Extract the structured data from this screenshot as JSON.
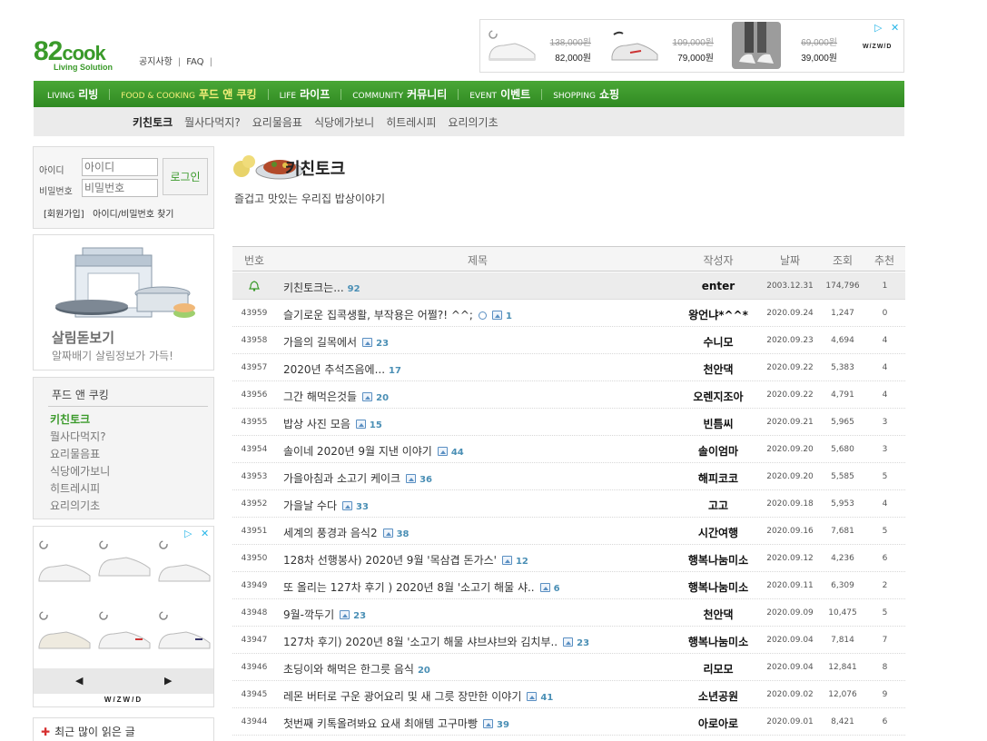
{
  "header": {
    "logo_text": "82cook",
    "logo_sub": "Living Solution",
    "links": [
      "공지사항",
      "FAQ"
    ]
  },
  "top_ad": {
    "items": [
      {
        "old_price": "138,000원",
        "new_price": "82,000원"
      },
      {
        "old_price": "109,000원",
        "new_price": "79,000원"
      },
      {
        "old_price": "69,000원",
        "new_price": "39,000원"
      }
    ],
    "brand": "W/ZW/D",
    "adchoice": "▷",
    "close": "✕"
  },
  "nav": [
    {
      "en": "LIVING",
      "ko": "리빙",
      "active": false
    },
    {
      "en": "FOOD & COOKING",
      "ko": "푸드 앤 쿠킹",
      "active": true
    },
    {
      "en": "LIFE",
      "ko": "라이프",
      "active": false
    },
    {
      "en": "COMMUNITY",
      "ko": "커뮤니티",
      "active": false
    },
    {
      "en": "EVENT",
      "ko": "이벤트",
      "active": false
    },
    {
      "en": "SHOPPING",
      "ko": "쇼핑",
      "active": false
    }
  ],
  "subnav": [
    "키친토크",
    "뭘사다먹지?",
    "요리물음표",
    "식당에가보니",
    "히트레시피",
    "요리의기초"
  ],
  "login": {
    "id_label": "아이디",
    "pw_label": "비밀번호",
    "id_placeholder": "아이디",
    "pw_placeholder": "비밀번호",
    "button": "로그인",
    "join": "[회원가입]",
    "find": "아이디/비밀번호 찾기"
  },
  "promo": {
    "title": "살림돋보기",
    "subtitle": "알짜배기 살림정보가 가득!"
  },
  "category": {
    "title": "푸드 앤 쿠킹",
    "items": [
      "키친토크",
      "뭘사다먹지?",
      "요리물음표",
      "식당에가보니",
      "히트레시피",
      "요리의기초"
    ]
  },
  "side_ad": {
    "brand": "W/ZW/D",
    "prev": "◀",
    "next": "▶"
  },
  "recent": {
    "plus": "✚",
    "label": "최근 많이 읽은 글"
  },
  "board": {
    "title": "키친토크",
    "description": "즐겁고 맛있는 우리집 밥상이야기",
    "headers": [
      "번호",
      "제목",
      "작성자",
      "날짜",
      "조회",
      "추천"
    ],
    "notice": {
      "title": "키친토크는...",
      "comments": "92",
      "writer": "enter",
      "date": "2003.12.31",
      "views": "174,796",
      "rec": "1"
    },
    "rows": [
      {
        "no": "43959",
        "title": "슬기로운 집콕생활, 부작용은 어쩔?! ^^;",
        "clock": true,
        "pic": true,
        "comments": "1",
        "writer": "왕언냐*^^*",
        "date": "2020.09.24",
        "views": "1,247",
        "rec": "0"
      },
      {
        "no": "43958",
        "title": "가을의 길목에서",
        "pic": true,
        "comments": "23",
        "writer": "수니모",
        "date": "2020.09.23",
        "views": "4,694",
        "rec": "4"
      },
      {
        "no": "43957",
        "title": "2020년 추석즈음에...",
        "pic": false,
        "comments": "17",
        "writer": "천안댁",
        "date": "2020.09.22",
        "views": "5,383",
        "rec": "4"
      },
      {
        "no": "43956",
        "title": "그간 해먹은것들",
        "pic": true,
        "comments": "20",
        "writer": "오렌지조아",
        "date": "2020.09.22",
        "views": "4,791",
        "rec": "4"
      },
      {
        "no": "43955",
        "title": "밥상 사진 모음",
        "pic": true,
        "comments": "15",
        "writer": "빈틈씨",
        "date": "2020.09.21",
        "views": "5,965",
        "rec": "3"
      },
      {
        "no": "43954",
        "title": "솔이네 2020년 9월 지낸 이야기",
        "pic": true,
        "comments": "44",
        "writer": "솔이엄마",
        "date": "2020.09.20",
        "views": "5,680",
        "rec": "3"
      },
      {
        "no": "43953",
        "title": "가을아침과 소고기 케이크",
        "pic": true,
        "comments": "36",
        "writer": "해피코코",
        "date": "2020.09.20",
        "views": "5,585",
        "rec": "5"
      },
      {
        "no": "43952",
        "title": "가을날 수다",
        "pic": true,
        "comments": "33",
        "writer": "고고",
        "date": "2020.09.18",
        "views": "5,953",
        "rec": "4"
      },
      {
        "no": "43951",
        "title": "세계의 풍경과 음식2",
        "pic": true,
        "comments": "38",
        "writer": "시간여행",
        "date": "2020.09.16",
        "views": "7,681",
        "rec": "5"
      },
      {
        "no": "43950",
        "title": "128차 선행봉사) 2020년 9월 '목삼겹 돈가스'",
        "pic": true,
        "comments": "12",
        "writer": "행복나눔미소",
        "date": "2020.09.12",
        "views": "4,236",
        "rec": "6"
      },
      {
        "no": "43949",
        "title": "또 올리는 127차 후기 ) 2020년 8월 '소고기 해물 샤..",
        "pic": true,
        "comments": "6",
        "writer": "행복나눔미소",
        "date": "2020.09.11",
        "views": "6,309",
        "rec": "2"
      },
      {
        "no": "43948",
        "title": "9월-깍두기",
        "pic": true,
        "comments": "23",
        "writer": "천안댁",
        "date": "2020.09.09",
        "views": "10,475",
        "rec": "5"
      },
      {
        "no": "43947",
        "title": "127차 후기) 2020년 8월 '소고기 해물 샤브샤브와 김치부..",
        "pic": true,
        "comments": "23",
        "writer": "행복나눔미소",
        "date": "2020.09.04",
        "views": "7,814",
        "rec": "7"
      },
      {
        "no": "43946",
        "title": "초딩이와 해먹은 한그릇 음식",
        "pic": false,
        "comments": "20",
        "writer": "리모모",
        "date": "2020.09.04",
        "views": "12,841",
        "rec": "8"
      },
      {
        "no": "43945",
        "title": "레몬 버터로 구운 광어요리 및 새 그릇 장만한 이야기",
        "pic": true,
        "comments": "41",
        "writer": "소년공원",
        "date": "2020.09.02",
        "views": "12,076",
        "rec": "9"
      },
      {
        "no": "43944",
        "title": "첫번째 키톡올려봐요 요새 최애템 고구마빵",
        "pic": true,
        "comments": "39",
        "writer": "아로아로",
        "date": "2020.09.01",
        "views": "8,421",
        "rec": "6"
      }
    ]
  }
}
